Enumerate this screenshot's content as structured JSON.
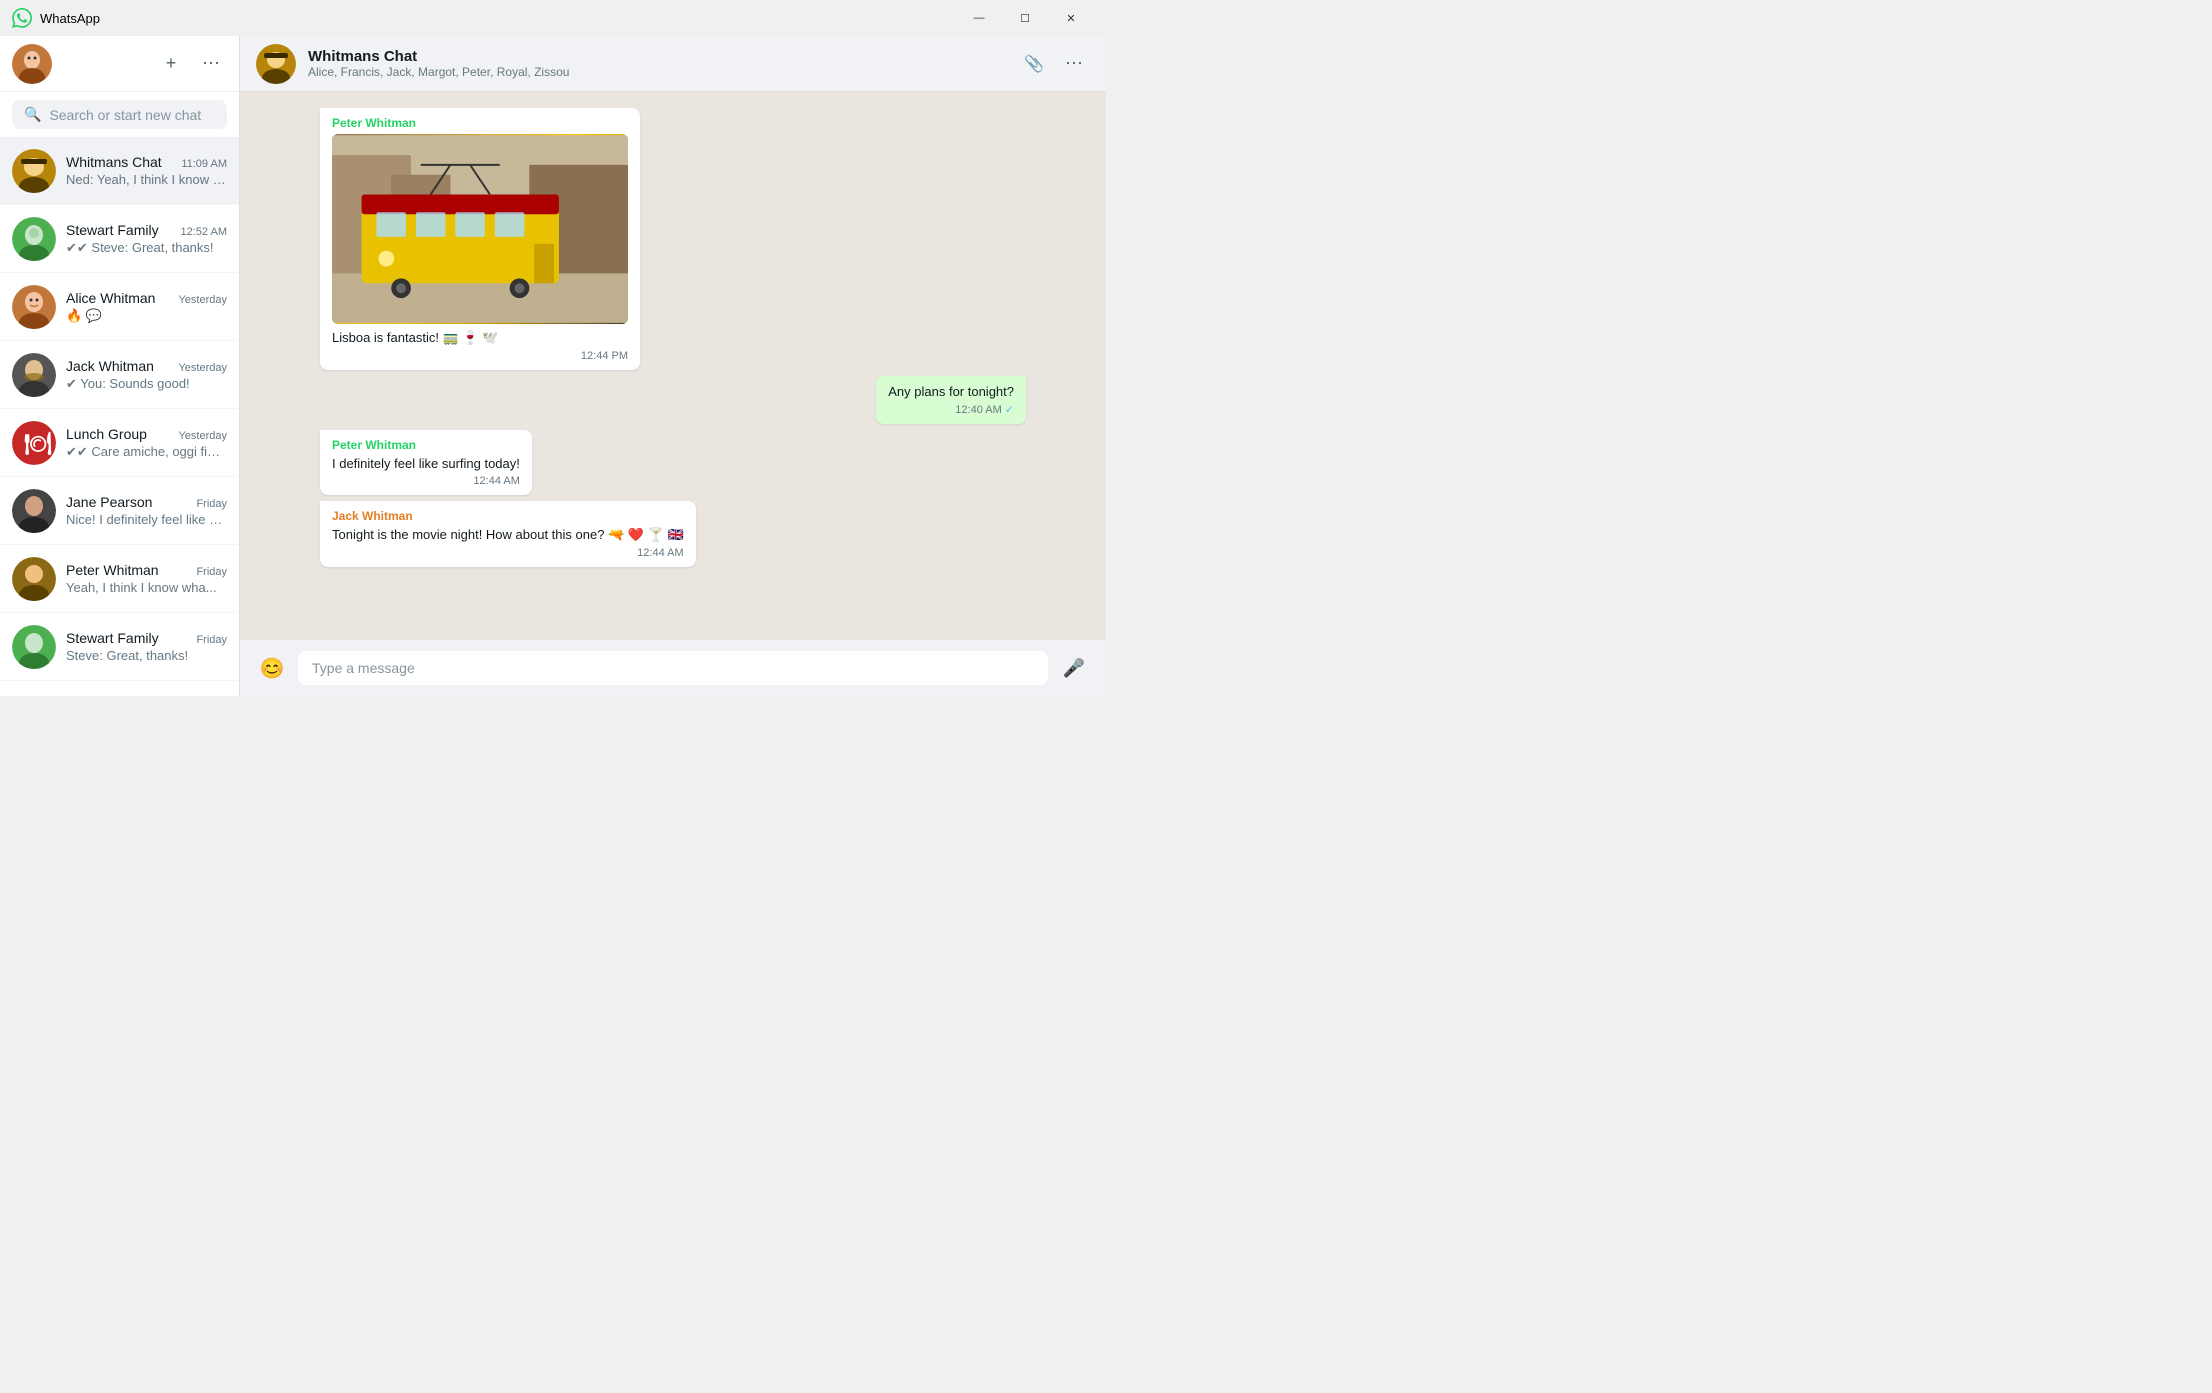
{
  "app": {
    "title": "WhatsApp",
    "logo_symbol": "📱"
  },
  "titlebar": {
    "title": "WhatsApp",
    "minimize": "—",
    "maximize": "☐",
    "close": "✕"
  },
  "left_panel": {
    "search_placeholder": "Search or start new chat",
    "new_chat_label": "+",
    "menu_label": "⋯",
    "chats": [
      {
        "id": "whitmans-chat",
        "name": "Whitmans Chat",
        "time": "11:09 AM",
        "preview": "Ned: Yeah, I think I know wha...",
        "avatar_type": "group",
        "avatar_text": "🎩",
        "avatar_color": "#b8860b"
      },
      {
        "id": "stewart-family",
        "name": "Stewart Family",
        "time": "12:52 AM",
        "preview": "✔✔ Steve: Great, thanks!",
        "avatar_type": "group",
        "avatar_text": "🌿",
        "avatar_color": "#4caf50"
      },
      {
        "id": "alice-whitman",
        "name": "Alice Whitman",
        "time": "Yesterday",
        "preview": "🔥 💬",
        "avatar_type": "person",
        "avatar_text": "👩",
        "avatar_color": "#c2773a"
      },
      {
        "id": "jack-whitman",
        "name": "Jack Whitman",
        "time": "Yesterday",
        "preview": "✔ You: Sounds good!",
        "avatar_type": "person",
        "avatar_text": "🧔",
        "avatar_color": "#555"
      },
      {
        "id": "lunch-group",
        "name": "Lunch Group",
        "time": "Yesterday",
        "preview": "✔✔ Care amiche, oggi finalmente posso",
        "avatar_type": "group",
        "avatar_text": "🍽️",
        "avatar_color": "#c62828"
      },
      {
        "id": "jane-pearson",
        "name": "Jane Pearson",
        "time": "Friday",
        "preview": "Nice! I definitely feel like surfing",
        "avatar_type": "person",
        "avatar_text": "👩",
        "avatar_color": "#444"
      },
      {
        "id": "peter-whitman",
        "name": "Peter Whitman",
        "time": "Friday",
        "preview": "Yeah, I think I know wha...",
        "avatar_type": "person",
        "avatar_text": "👨",
        "avatar_color": "#8b6914"
      },
      {
        "id": "stewart-family-2",
        "name": "Stewart Family",
        "time": "Friday",
        "preview": "Steve: Great, thanks!",
        "avatar_type": "group",
        "avatar_text": "🌿",
        "avatar_color": "#4caf50"
      }
    ]
  },
  "chat_header": {
    "name": "Whitmans Chat",
    "members": "Alice, Francis, Jack, Margot, Peter, Royal, Zissou",
    "attach_label": "📎",
    "menu_label": "⋯"
  },
  "messages": [
    {
      "id": "msg1",
      "type": "received",
      "sender": "Peter Whitman",
      "sender_color": "#25d366",
      "has_image": true,
      "text": "Lisboa is fantastic! 🚃 🍷 🕊️",
      "time": "12:44 PM"
    },
    {
      "id": "msg2",
      "type": "sent",
      "sender": "",
      "sender_color": "",
      "has_image": false,
      "text": "Any plans for tonight?",
      "time": "12:40 AM",
      "check": "✓"
    },
    {
      "id": "msg3",
      "type": "received",
      "sender": "Peter Whitman",
      "sender_color": "#25d366",
      "has_image": false,
      "text": "I definitely feel like surfing today!",
      "time": "12:44 AM"
    },
    {
      "id": "msg4",
      "type": "received",
      "sender": "Jack Whitman",
      "sender_color": "#e67e22",
      "has_image": false,
      "text": "Tonight is the movie night! How about this one? 🔫 ❤️ 🍸 🇬🇧",
      "time": "12:44 AM"
    }
  ],
  "input": {
    "placeholder": "Type a message",
    "emoji_label": "😊",
    "mic_label": "🎤"
  }
}
